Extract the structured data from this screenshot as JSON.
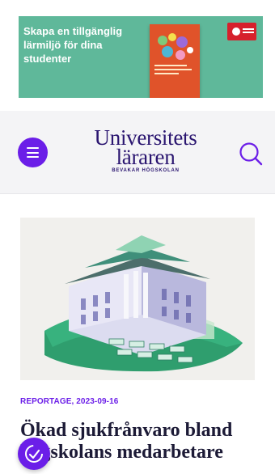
{
  "ad": {
    "headline": "Skapa en tillgänglig lärmiljö för dina studenter",
    "colors": {
      "background": "#5fb89a",
      "book": "#e0532a",
      "publisher": "#d6202c"
    },
    "icons": [
      "book-cover-image",
      "publisher-logo"
    ]
  },
  "header": {
    "logo_line1": "Universitets",
    "logo_line2": "läraren",
    "logo_tagline": "BEVAKAR HÖGSKOLAN",
    "colors": {
      "accent": "#6b1ee8",
      "logo": "#2a1570",
      "background": "#f4f4f6"
    },
    "icons": [
      "hamburger-menu-icon",
      "search-icon"
    ]
  },
  "article": {
    "meta": "REPORTAGE, 2023-09-16",
    "headline": "Ökad sjukfrånvaro bland högskolans medarbetare",
    "image_subject": "isometric-university-building-illustration"
  },
  "accessibility": {
    "icon": "accessibility-icon"
  }
}
